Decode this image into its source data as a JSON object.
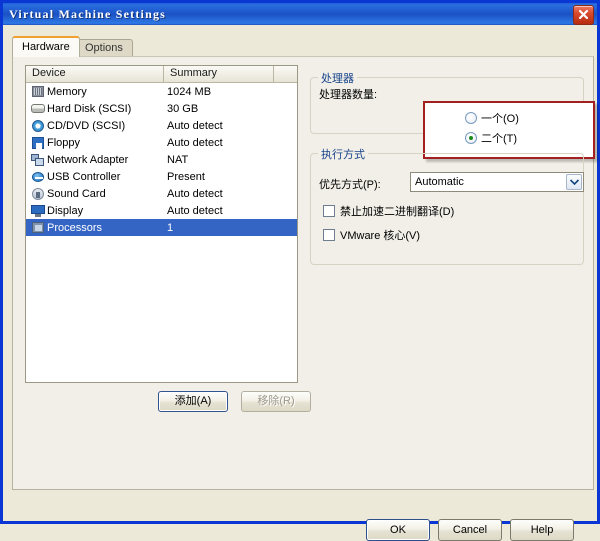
{
  "window": {
    "title": "Virtual Machine Settings",
    "close_label": "Close"
  },
  "tabs": [
    {
      "label": "Hardware",
      "active": true
    },
    {
      "label": "Options",
      "active": false
    }
  ],
  "device_list": {
    "columns": [
      "Device",
      "Summary",
      ""
    ],
    "rows": [
      {
        "icon": "memory-icon",
        "device": "Memory",
        "summary": "1024 MB",
        "selected": false
      },
      {
        "icon": "hard-disk-icon",
        "device": "Hard Disk (SCSI)",
        "summary": "30 GB",
        "selected": false
      },
      {
        "icon": "cd-dvd-icon",
        "device": "CD/DVD (SCSI)",
        "summary": "Auto detect",
        "selected": false
      },
      {
        "icon": "floppy-icon",
        "device": "Floppy",
        "summary": "Auto detect",
        "selected": false
      },
      {
        "icon": "network-adapter-icon",
        "device": "Network Adapter",
        "summary": "NAT",
        "selected": false
      },
      {
        "icon": "usb-controller-icon",
        "device": "USB Controller",
        "summary": "Present",
        "selected": false
      },
      {
        "icon": "sound-card-icon",
        "device": "Sound Card",
        "summary": "Auto detect",
        "selected": false
      },
      {
        "icon": "display-icon",
        "device": "Display",
        "summary": "Auto detect",
        "selected": false
      },
      {
        "icon": "processors-icon",
        "device": "Processors",
        "summary": "1",
        "selected": true
      }
    ]
  },
  "list_buttons": {
    "add_label": "添加(A)",
    "remove_label": "移除(R)",
    "remove_disabled": true
  },
  "processors_group": {
    "legend": "处理器",
    "count_label": "处理器数量:",
    "options": [
      {
        "label": "一个(O)",
        "checked": false
      },
      {
        "label": "二个(T)",
        "checked": true
      }
    ],
    "highlight_color": "#a41f1f"
  },
  "execution_group": {
    "legend": "执行方式",
    "priority_label": "优先方式(P):",
    "priority_value": "Automatic",
    "dropdown_icon": "chevron-down-icon",
    "checkboxes": [
      {
        "label": "禁止加速二进制翻译(D)",
        "checked": false
      },
      {
        "label": "VMware 核心(V)",
        "checked": false
      }
    ]
  },
  "footer": {
    "ok_label": "OK",
    "cancel_label": "Cancel",
    "help_label": "Help"
  }
}
